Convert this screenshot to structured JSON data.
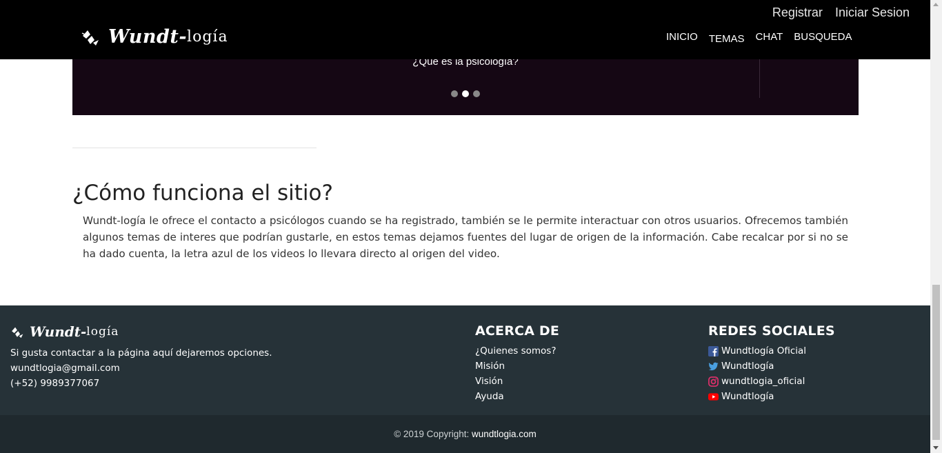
{
  "header": {
    "brand_bold": "Wundt-",
    "brand_light": "logía",
    "auth": {
      "register": "Registrar",
      "login": "Iniciar Sesion"
    },
    "menu": [
      "INICIO",
      "TEMAS",
      "CHAT",
      "BUSQUEDA"
    ]
  },
  "carousel": {
    "caption": "¿Qué es la psicología?",
    "slide_count": 3,
    "active_index": 1
  },
  "section": {
    "title": "¿Cómo funciona el sitio?",
    "body": "Wundt-logía le ofrece el contacto a psicólogos cuando se ha registrado, también se le permite interactuar con otros usuarios. Ofrecemos también algunos temas de interes que podrían gustarle, en estos temas dejamos fuentes del lugar de origen de la información. Cabe recalcar por si no se ha dado cuenta, la letra azul de los videos lo llevara directo al origen del video."
  },
  "footer": {
    "brand_bold": "Wundt-",
    "brand_light": "logía",
    "contact_text": "Si gusta contactar a la página aquí dejaremos opciones.",
    "email": "wundtlogia@gmail.com",
    "phone": "(+52) 9989377067",
    "about_heading": "ACERCA DE",
    "about_links": [
      "¿Quienes somos?",
      "Misión",
      "Visión",
      "Ayuda"
    ],
    "social_heading": "REDES SOCIALES",
    "social": [
      {
        "icon": "facebook-icon",
        "label": "Wundtlogía Oficial",
        "color": "#3b5998"
      },
      {
        "icon": "twitter-icon",
        "label": "Wundtlogía",
        "color": "#1da1f2"
      },
      {
        "icon": "instagram-icon",
        "label": "wundtlogia_oficial",
        "color": "#e1306c"
      },
      {
        "icon": "youtube-icon",
        "label": "Wundtlogía",
        "color": "#ff0000"
      }
    ],
    "copyright_prefix": "© 2019 Copyright: ",
    "copyright_link": "wundtlogia.com"
  },
  "colors": {
    "navbar": "#000000",
    "carousel": "#150714",
    "footer": "#263238",
    "footer_bottom": "#1f292e"
  }
}
